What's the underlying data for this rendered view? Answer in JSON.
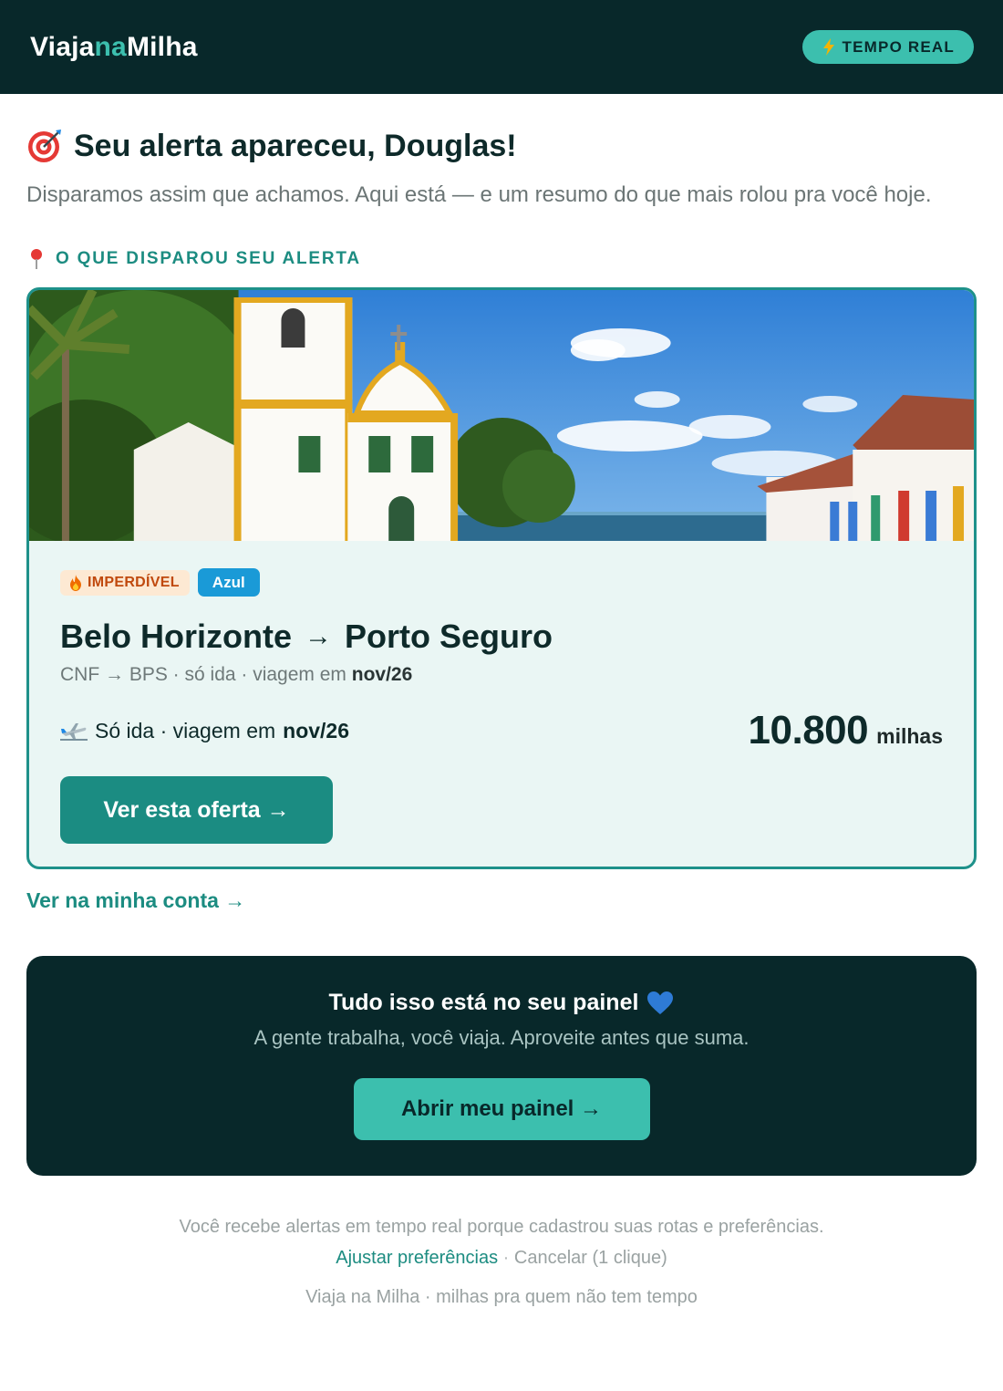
{
  "header": {
    "logo_part1": "Viaja",
    "logo_part2": "na",
    "logo_part3": "Milha",
    "badge": "TEMPO REAL"
  },
  "greeting": {
    "title": "Seu alerta apareceu, Douglas!",
    "subtitle": "Disparamos assim que achamos. Aqui está — e um resumo do que mais rolou pra você hoje."
  },
  "section": {
    "label": "O QUE DISPAROU SEU ALERTA"
  },
  "offer": {
    "tag_hot": "IMPERDÍVEL",
    "tag_airline": "Azul",
    "origin": "Belo Horizonte",
    "arrow": "→",
    "destination": "Porto Seguro",
    "meta_prefix": "CNF → BPS · só ida · viagem em",
    "meta_date": "nov/26",
    "trip_prefix": "Só ida · viagem em",
    "trip_date": "nov/26",
    "price_value": "10.800",
    "price_unit": "milhas",
    "cta": "Ver esta oferta →"
  },
  "account_link": "Ver na minha conta →",
  "panel": {
    "title": "Tudo isso está no seu painel",
    "subtitle": "A gente trabalha, você viaja. Aproveite antes que suma.",
    "cta": "Abrir meu painel →"
  },
  "footer": {
    "reason": "Você recebe alertas em tempo real porque cadastrou suas rotas e preferências.",
    "preferences_link": "Ajustar preferências",
    "separator": "·",
    "cancel_link": "Cancelar (1 clique)",
    "brand_line": "Viaja na Milha · milhas pra quem não tem tempo"
  },
  "colors": {
    "header_bg": "#08282a",
    "accent": "#3cbfae",
    "primary": "#1b8c82",
    "card_bg": "#eaf6f4",
    "airline_tag": "#1a9ad7"
  },
  "icons": {
    "badge": "lightning-icon",
    "greeting": "target-icon",
    "section": "pin-icon",
    "hot_tag": "fire-icon",
    "trip": "plane-icon",
    "panel": "blue-heart-icon"
  }
}
